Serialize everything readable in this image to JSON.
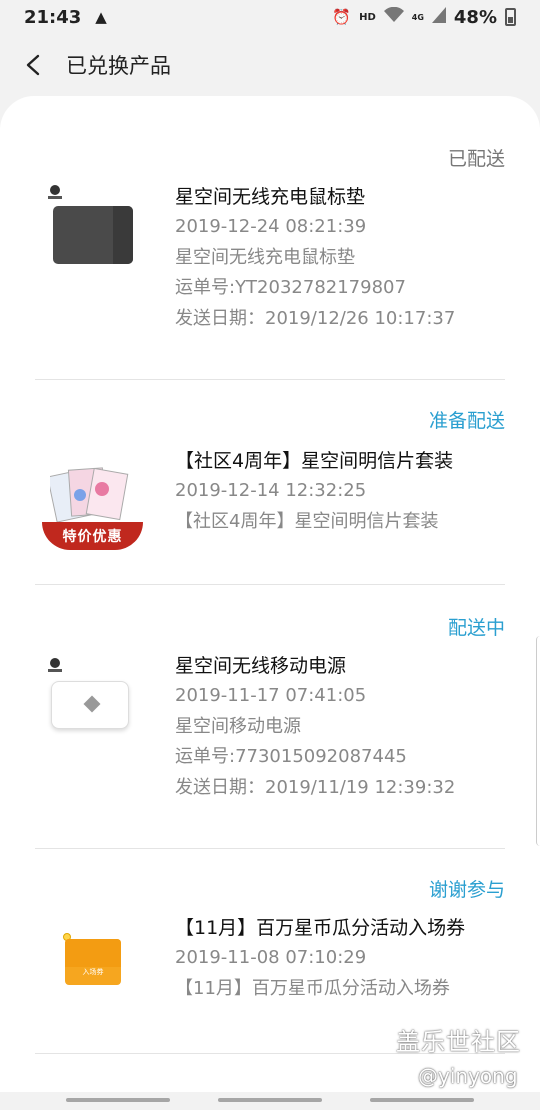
{
  "status_bar": {
    "time": "21:43",
    "hd": "HD",
    "network": "4G",
    "battery": "48%"
  },
  "header": {
    "title": "已兑换产品"
  },
  "orders": [
    {
      "status": "已配送",
      "status_color": "#777777",
      "name": "星空间无线充电鼠标垫",
      "date": "2019-12-24 08:21:39",
      "desc": "星空间无线充电鼠标垫",
      "waybill": "运单号:YT2032782179807",
      "ship_date": "发送日期：2019/12/26 10:17:37",
      "thumb_icon": "mouse-pad-image"
    },
    {
      "status": "准备配送",
      "status_color": "#2a9fd0",
      "name": "【社区4周年】星空间明信片套装",
      "date": "2019-12-14 12:32:25",
      "desc": "【社区4周年】星空间明信片套装",
      "badge": "特价优惠",
      "thumb_icon": "postcard-set-image"
    },
    {
      "status": "配送中",
      "status_color": "#2a9fd0",
      "name": "星空间无线移动电源",
      "date": "2019-11-17 07:41:05",
      "desc": "星空间移动电源",
      "waybill": "运单号:773015092087445",
      "ship_date": "发送日期：2019/11/19 12:39:32",
      "thumb_icon": "power-bank-image"
    },
    {
      "status": "谢谢参与",
      "status_color": "#2a9fd0",
      "name": "【11月】百万星币瓜分活动入场券",
      "date": "2019-11-08 07:10:29",
      "desc": "【11月】百万星币瓜分活动入场券",
      "ticket_label": "入场券",
      "thumb_icon": "ticket-image"
    }
  ],
  "watermark": {
    "brand": "盖乐世社区",
    "user": "@yinyong"
  }
}
